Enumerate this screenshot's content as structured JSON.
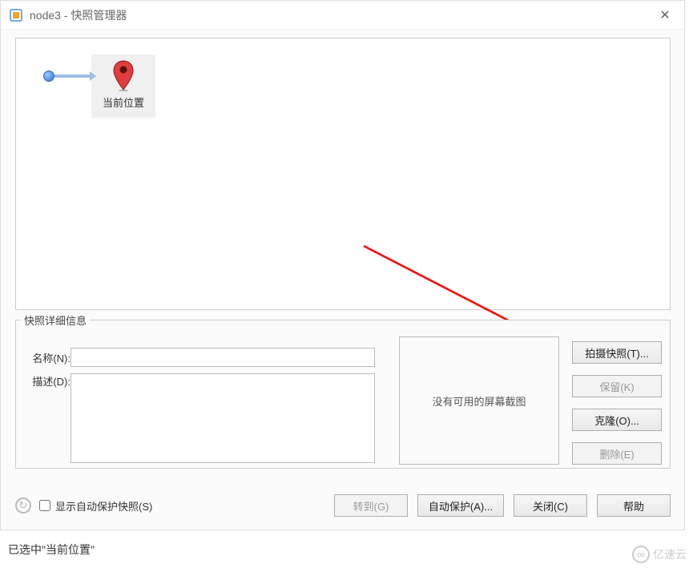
{
  "titlebar": {
    "title": "node3 - 快照管理器"
  },
  "canvas": {
    "current_location_label": "当前位置"
  },
  "details": {
    "legend": "快照详细信息",
    "name_label": "名称(N):",
    "desc_label": "描述(D):",
    "name_value": "",
    "desc_value": "",
    "no_screenshot": "没有可用的屏幕截图"
  },
  "side_buttons": {
    "take_snapshot": "拍摄快照(T)...",
    "keep": "保留(K)",
    "clone": "克隆(O)...",
    "delete": "删除(E)"
  },
  "footer": {
    "show_autoprotect": "显示自动保护快照(S)",
    "goto": "转到(G)",
    "autoprotect": "自动保护(A)...",
    "close": "关闭(C)",
    "help": "帮助"
  },
  "statusbar": {
    "text": "已选中\"当前位置\""
  },
  "watermark": "亿速云"
}
